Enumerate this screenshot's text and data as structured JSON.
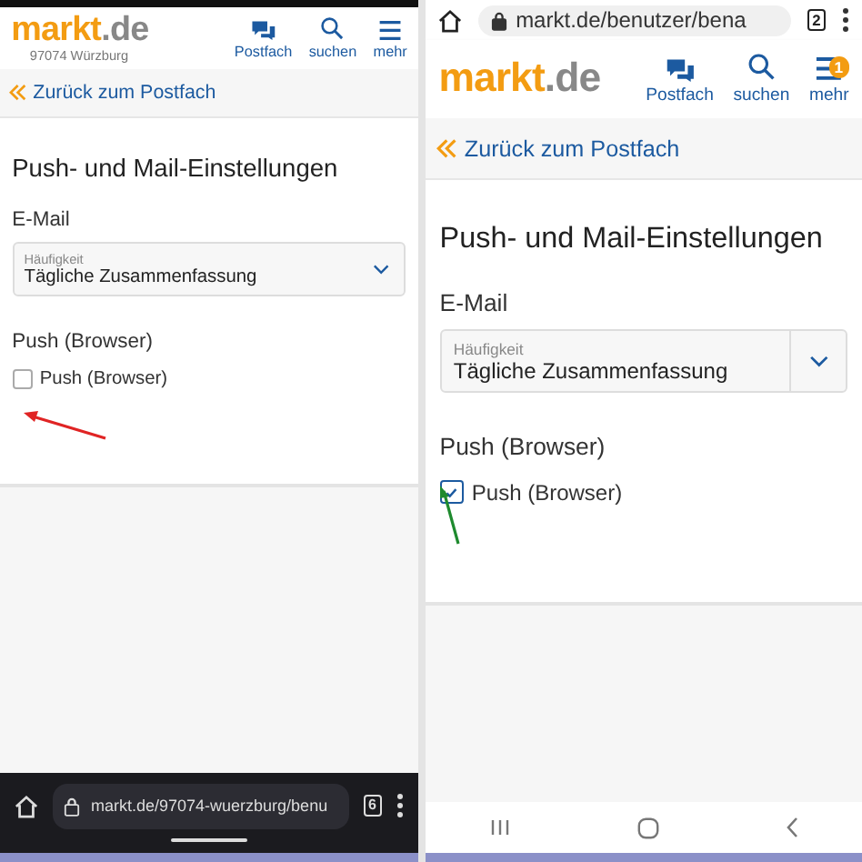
{
  "screens": [
    {
      "kind": "dark_bottom_bar",
      "header": {
        "logo_main": "markt",
        "logo_suffix": ".de",
        "location": "97074 Würzburg",
        "nav": [
          {
            "kind": "chat",
            "label": "Postfach"
          },
          {
            "kind": "search",
            "label": "suchen"
          },
          {
            "kind": "menu",
            "label": "mehr"
          }
        ]
      },
      "back_link": "Zurück zum Postfach",
      "title": "Push- und Mail-Einstellungen",
      "email_heading": "E-Mail",
      "select": {
        "label": "Häufigkeit",
        "value": "Tägliche Zusammenfassung"
      },
      "push_heading": "Push (Browser)",
      "checkbox": {
        "label": "Push (Browser)",
        "checked": false
      },
      "arrow": {
        "color": "#e02424"
      },
      "browser_bar": {
        "url": "markt.de/97074-wuerzburg/benu",
        "tab_count": "6"
      }
    },
    {
      "kind": "light_top_bar",
      "header": {
        "logo_main": "markt",
        "logo_suffix": ".de",
        "nav": [
          {
            "kind": "chat",
            "label": "Postfach"
          },
          {
            "kind": "search",
            "label": "suchen"
          },
          {
            "kind": "menu",
            "label": "mehr",
            "badge": "1"
          }
        ]
      },
      "back_link": "Zurück zum Postfach",
      "title": "Push- und Mail-Einstellungen",
      "email_heading": "E-Mail",
      "select": {
        "label": "Häufigkeit",
        "value": "Tägliche Zusammenfassung"
      },
      "push_heading": "Push (Browser)",
      "checkbox": {
        "label": "Push (Browser)",
        "checked": true
      },
      "arrow": {
        "color": "#1e8a2e"
      },
      "browser_bar": {
        "url": "markt.de/benutzer/bena",
        "tab_count": "2"
      }
    }
  ]
}
